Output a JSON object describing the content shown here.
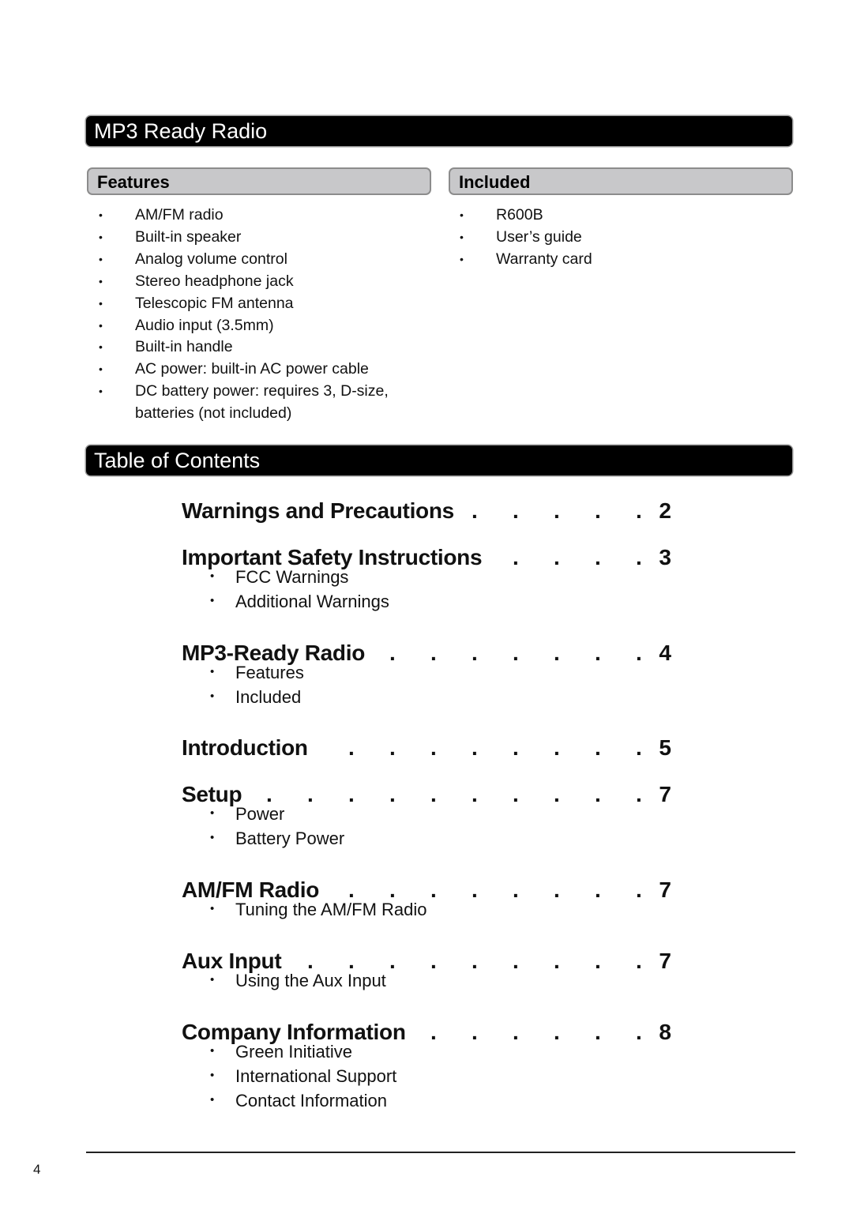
{
  "sections": {
    "mp3_title": "MP3 Ready Radio",
    "toc_title": "Table of Contents"
  },
  "features": {
    "heading": "Features",
    "items": [
      "AM/FM radio",
      "Built-in speaker",
      "Analog volume control",
      "Stereo headphone jack",
      "Telescopic FM antenna",
      "Audio input (3.5mm)",
      "Built-in handle",
      "AC power: built-in AC power cable",
      "DC battery power: requires 3, D-size,",
      "batteries (not included)"
    ]
  },
  "included": {
    "heading": "Included",
    "items": [
      "R600B",
      "User’s guide",
      "Warranty card"
    ]
  },
  "toc": {
    "bullet": "•",
    "leader": ".",
    "entries": [
      {
        "title": "Warnings and Precautions",
        "page": "2",
        "subs": []
      },
      {
        "title": "Important Safety Instructions",
        "page": "3",
        "subs": [
          "FCC Warnings",
          "Additional Warnings"
        ]
      },
      {
        "title": "MP3-Ready Radio",
        "page": "4",
        "subs": [
          "Features",
          "Included"
        ]
      },
      {
        "title": "Introduction",
        "page": "5",
        "subs": []
      },
      {
        "title": "Setup",
        "page": "7",
        "subs": [
          "Power",
          "Battery Power"
        ]
      },
      {
        "title": "AM/FM Radio",
        "page": "7",
        "subs": [
          "Tuning the AM/FM Radio"
        ]
      },
      {
        "title": "Aux Input",
        "page": "7",
        "subs": [
          "Using the Aux Input"
        ]
      },
      {
        "title": "Company Information",
        "page": "8",
        "subs": [
          "Green Initiative",
          "International Support",
          "Contact Information"
        ]
      }
    ]
  },
  "footer": {
    "page_number": "4"
  }
}
